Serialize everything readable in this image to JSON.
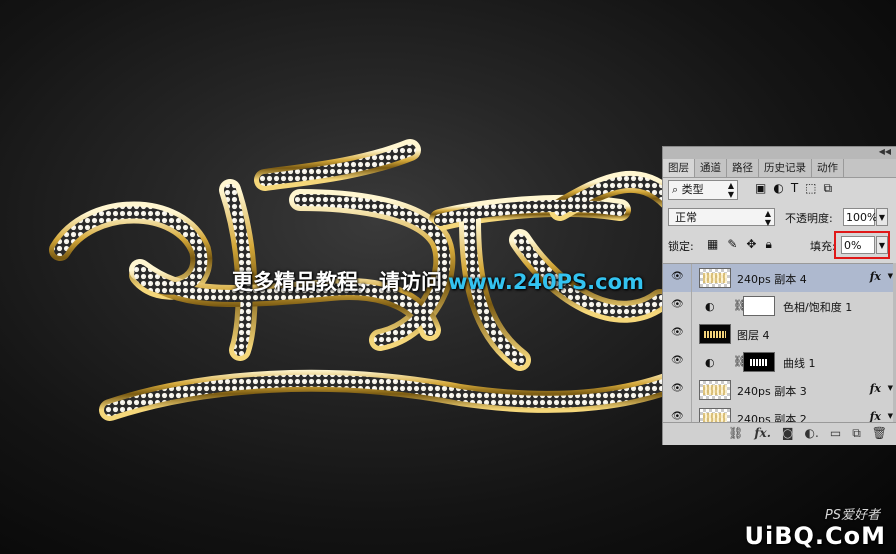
{
  "watermark": {
    "text": "更多精品教程，请访问",
    "url": "www.240PS.com"
  },
  "logo": {
    "main": "UiBQ.CoM",
    "sub": "PS爱好者"
  },
  "panel": {
    "tabs": [
      "图层",
      "通道",
      "路径",
      "历史记录",
      "动作"
    ],
    "active_tab": "图层",
    "filter_label": "类型",
    "blend_mode": "正常",
    "opacity_label": "不透明度:",
    "opacity_value": "100%",
    "lock_label": "锁定:",
    "fill_label": "填充:",
    "fill_value": "0%",
    "layers": [
      {
        "name": "240ps 副本 4",
        "selected": true,
        "fx": "fx"
      },
      {
        "name": "色相/饱和度 1",
        "selected": false
      },
      {
        "name": "图层 4",
        "selected": false
      },
      {
        "name": "曲线 1",
        "selected": false
      },
      {
        "name": "240ps 副本 3",
        "selected": false,
        "fx": "fx"
      },
      {
        "name": "240ps 副本 2",
        "selected": false,
        "fx": "fx"
      }
    ],
    "highlight_color": "#e01818"
  },
  "colors": {
    "url": "#33c3f0",
    "selected_layer": "#aeb9cf",
    "gold": "#d9b860"
  }
}
